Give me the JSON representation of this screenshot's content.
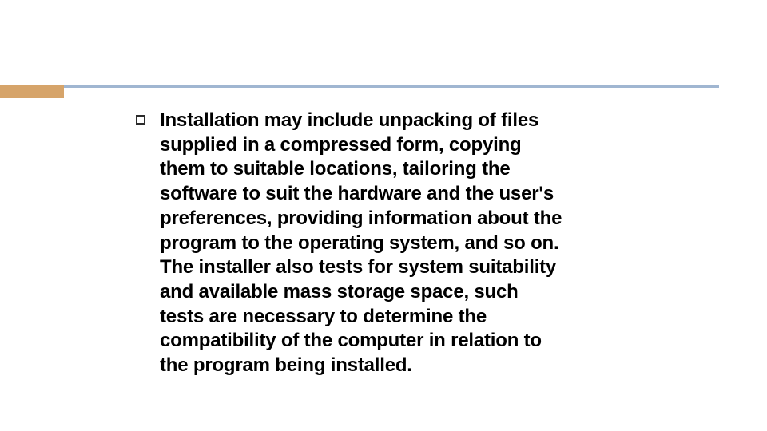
{
  "colors": {
    "accent": "#d6a46a",
    "rule": "#a0b6d1"
  },
  "body": {
    "bullet_icon": "hollow-square",
    "paragraph": "Installation may include unpacking of files supplied in a compressed form, copying them to suitable locations, tailoring the software to suit the hardware and the user's preferences, providing information about the program to the operating system, and so on. The installer also tests for system suitability and available mass storage space, such tests are necessary to determine the compatibility of the computer in relation to the program being installed."
  }
}
